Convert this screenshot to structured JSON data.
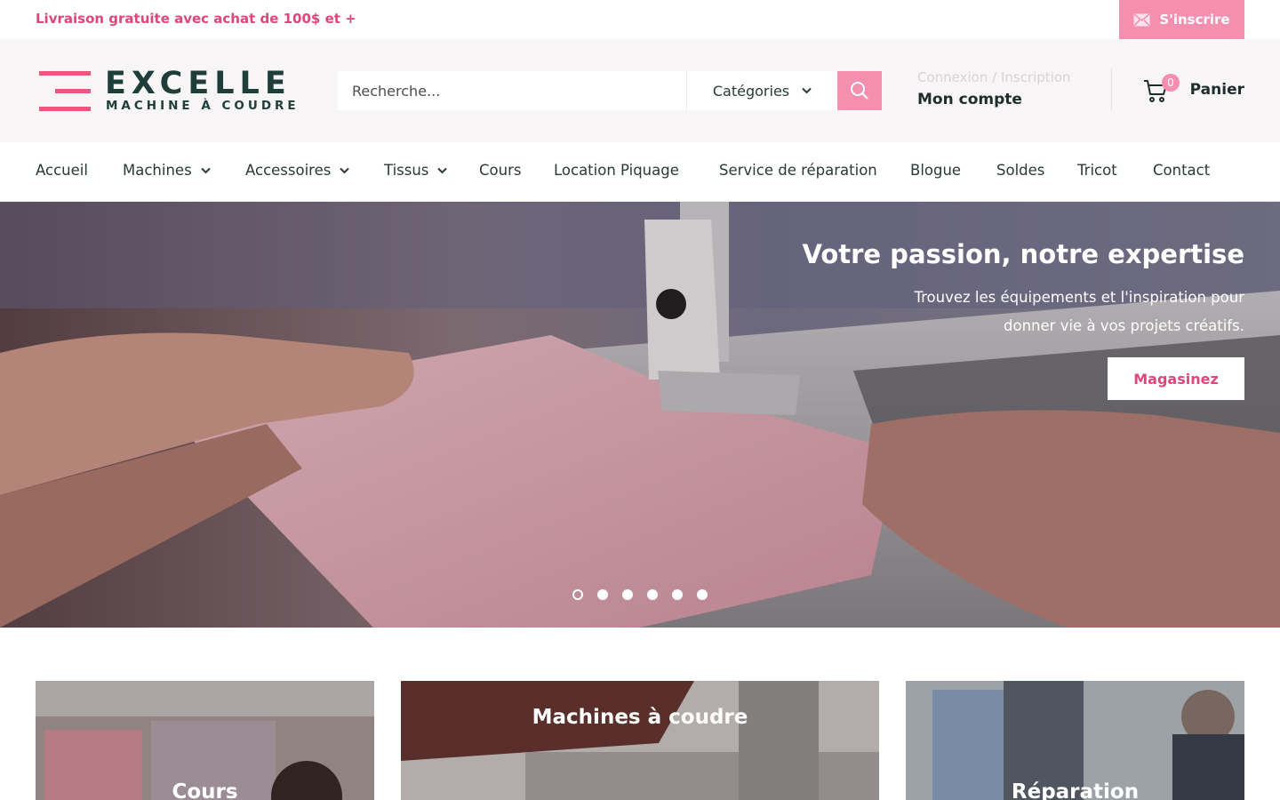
{
  "announcement": {
    "promo": "Livraison gratuite avec achat de 100$ et +",
    "signup": "S'inscrire"
  },
  "brand": {
    "name": "EXCELLE",
    "tagline": "MACHINE À COUDRE"
  },
  "search": {
    "placeholder": "Recherche...",
    "category": "Catégories"
  },
  "account": {
    "login": "Connexion / Inscription",
    "my_account": "Mon compte"
  },
  "cart": {
    "count": "0",
    "label": "Panier"
  },
  "nav": [
    {
      "label": "Accueil"
    },
    {
      "label": "Machines"
    },
    {
      "label": "Accessoires"
    },
    {
      "label": "Tissus"
    },
    {
      "label": "Cours"
    },
    {
      "label": "Location Piquage"
    },
    {
      "label": "Service de réparation"
    },
    {
      "label": "Blogue"
    },
    {
      "label": "Soldes"
    },
    {
      "label": "Tricot"
    },
    {
      "label": "Contact"
    }
  ],
  "hero": {
    "title": "Votre passion, notre expertise",
    "subtitle": "Trouvez les équipements et l'inspiration pour donner vie à vos projets créatifs.",
    "cta": "Magasinez",
    "slides": 6,
    "active_slide": 1
  },
  "cards": [
    {
      "title": "Cours"
    },
    {
      "title": "Machines à coudre"
    },
    {
      "title": "Réparation"
    }
  ],
  "colors": {
    "accent": "#f48fb0",
    "accent_text": "#e0457b",
    "brand": "#1f3e3a",
    "header_bg": "#f7f5f6"
  },
  "icons": {
    "signup": "mail-icon",
    "search": "search-icon",
    "cart": "cart-icon",
    "dropdown": "chevron-down-icon"
  }
}
